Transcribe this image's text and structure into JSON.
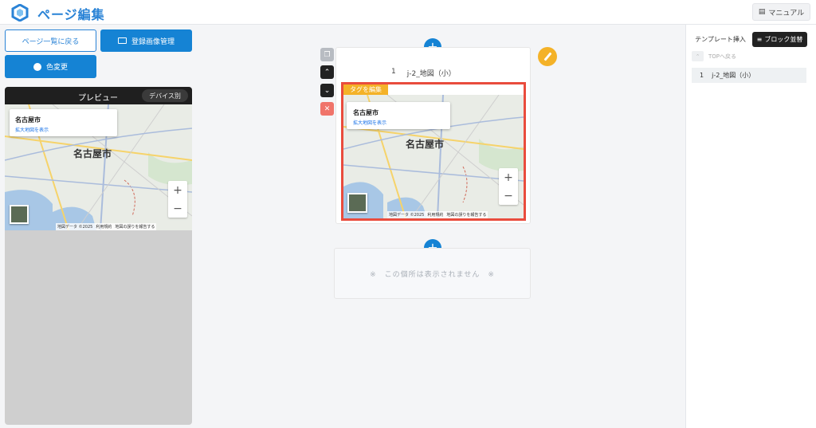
{
  "header": {
    "title": "ページ編集",
    "manual_label": "マニュアル"
  },
  "left": {
    "back_button": "ページ一覧に戻る",
    "images_button": "登録画像管理",
    "color_button": "色変更",
    "preview": {
      "title": "プレビュー",
      "device_button": "デバイス別"
    }
  },
  "map": {
    "city": "名古屋市",
    "enlarge_link": "拡大地図を表示",
    "big_label": "名古屋市",
    "zoom_in": "+",
    "zoom_out": "−",
    "attribution_data": "地図データ ©2025",
    "attribution_terms": "利用規約",
    "attribution_report": "地図の誤りを報告する"
  },
  "editor": {
    "block_number": "1",
    "block_name": "j-2_地図（小）",
    "tag_edit_label": "タグを編集",
    "add_button": "+",
    "empty_message": "※　この個所は表示されません　※"
  },
  "right": {
    "tab_template": "テンプレート挿入",
    "tab_block": "ブロック並替",
    "top_link": "TOPへ戻る",
    "items": [
      {
        "number": "1",
        "name": "j-2_地図（小）"
      }
    ]
  },
  "colors": {
    "primary": "#1583d4",
    "accent_orange": "#f4b228",
    "danger": "#e94c3d"
  }
}
